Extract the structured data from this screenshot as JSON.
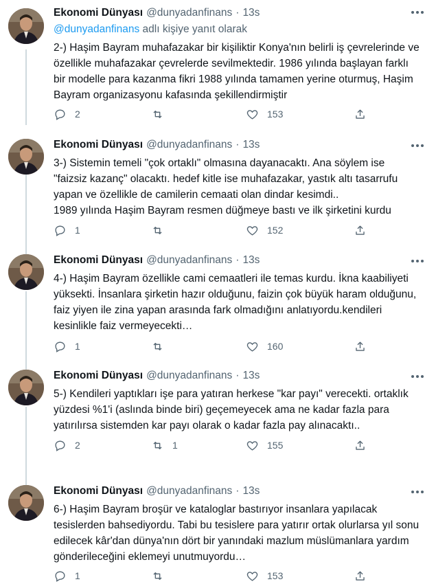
{
  "tweets": [
    {
      "name": "Ekonomi Dünyası",
      "handle": "@dunyadanfinans",
      "time": "13s",
      "reply_prefix": "@dunyadanfinans",
      "reply_suffix": "adlı kişiye yanıt olarak",
      "lines": [
        "2-) Haşim Bayram muhafazakar bir kişiliktir Konya'nın belirli iş çevrelerinde ve",
        "özellikle muhafazakar çevrelerde sevilmektedir. 1986 yılında başlayan farklı",
        "bir modelle para kazanma fikri 1988 yılında tamamen yerine oturmuş, Haşim",
        "Bayram organizasyonu kafasında şekillendirmiştir"
      ],
      "replies": "2",
      "retweets": "",
      "likes": "153"
    },
    {
      "name": "Ekonomi Dünyası",
      "handle": "@dunyadanfinans",
      "time": "13s",
      "lines": [
        "3-) Sistemin temeli \"çok ortaklı\" olmasına dayanacaktı. Ana söylem ise",
        "\"faizsiz kazanç\" olacaktı. hedef kitle ise muhafazakar, yastık altı tasarrufu",
        "yapan ve özellikle de camilerin cemaati olan dindar kesimdi..",
        "1989 yılında Haşim Bayram resmen düğmeye bastı ve ilk şirketini kurdu"
      ],
      "replies": "1",
      "retweets": "",
      "likes": "152"
    },
    {
      "name": "Ekonomi Dünyası",
      "handle": "@dunyadanfinans",
      "time": "13s",
      "lines": [
        "4-) Haşim Bayram özellikle cami cemaatleri ile temas kurdu. İkna kaabiliyeti",
        "yüksekti. İnsanlara şirketin hazır olduğunu, faizin çok büyük haram olduğunu,",
        "faiz yiyen ile zina yapan arasında fark olmadığını anlatıyordu.kendileri",
        "kesinlikle faiz vermeyecekti…"
      ],
      "replies": "1",
      "retweets": "",
      "likes": "160"
    },
    {
      "name": "Ekonomi Dünyası",
      "handle": "@dunyadanfinans",
      "time": "13s",
      "lines": [
        "5-) Kendileri yaptıkları işe para yatıran herkese \"kar payı\" verecekti. ortaklık",
        "yüzdesi %1'i (aslında binde biri) geçemeyecek ama ne kadar fazla para",
        "yatırılırsa sistemden kar payı olarak o kadar fazla pay alınacaktı.."
      ],
      "replies": "2",
      "retweets": "1",
      "likes": "155"
    },
    {
      "name": "Ekonomi Dünyası",
      "handle": "@dunyadanfinans",
      "time": "13s",
      "lines": [
        "6-) Haşim Bayram broşür ve kataloglar bastırıyor insanlara yapılacak",
        "tesislerden bahsediyordu. Tabi bu tesislere para yatırır ortak olurlarsa yıl sonu",
        "edilecek kâr'dan dünya'nın dört bir yanındaki mazlum müslümanlara yardım",
        "gönderileceğini eklemeyi unutmuyordu…"
      ],
      "replies": "1",
      "retweets": "",
      "likes": "153"
    }
  ],
  "icons": {
    "reply": "reply-icon",
    "retweet": "retweet-icon",
    "like": "heart-icon",
    "share": "share-icon",
    "more": "more-icon",
    "avatar": "avatar"
  },
  "colors": {
    "link": "#1d9bf0",
    "secondary_text": "#536471",
    "primary_text": "#0f1419",
    "thread_line": "#cfd9de"
  }
}
